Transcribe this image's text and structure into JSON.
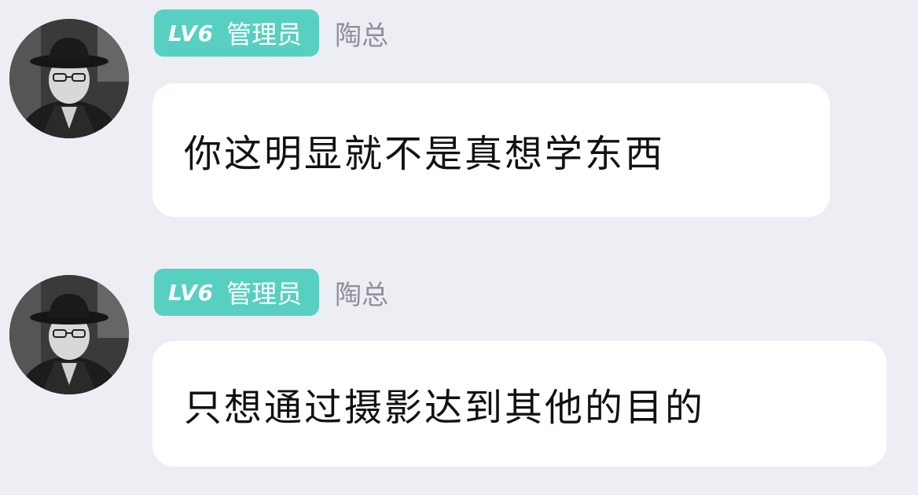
{
  "messages": [
    {
      "badge": {
        "level": "LV6",
        "role": "管理员"
      },
      "sender": "陶总",
      "text": "你这明显就不是真想学东西",
      "avatar_icon": "person-with-cowboy-hat-photo"
    },
    {
      "badge": {
        "level": "LV6",
        "role": "管理员"
      },
      "sender": "陶总",
      "text": "只想通过摄影达到其他的目的",
      "avatar_icon": "person-with-cowboy-hat-photo"
    }
  ],
  "colors": {
    "background": "#eceef3",
    "badge": "#57d0c1",
    "bubble": "#ffffff",
    "sender_name": "#8d9098",
    "message_text": "#111111"
  }
}
